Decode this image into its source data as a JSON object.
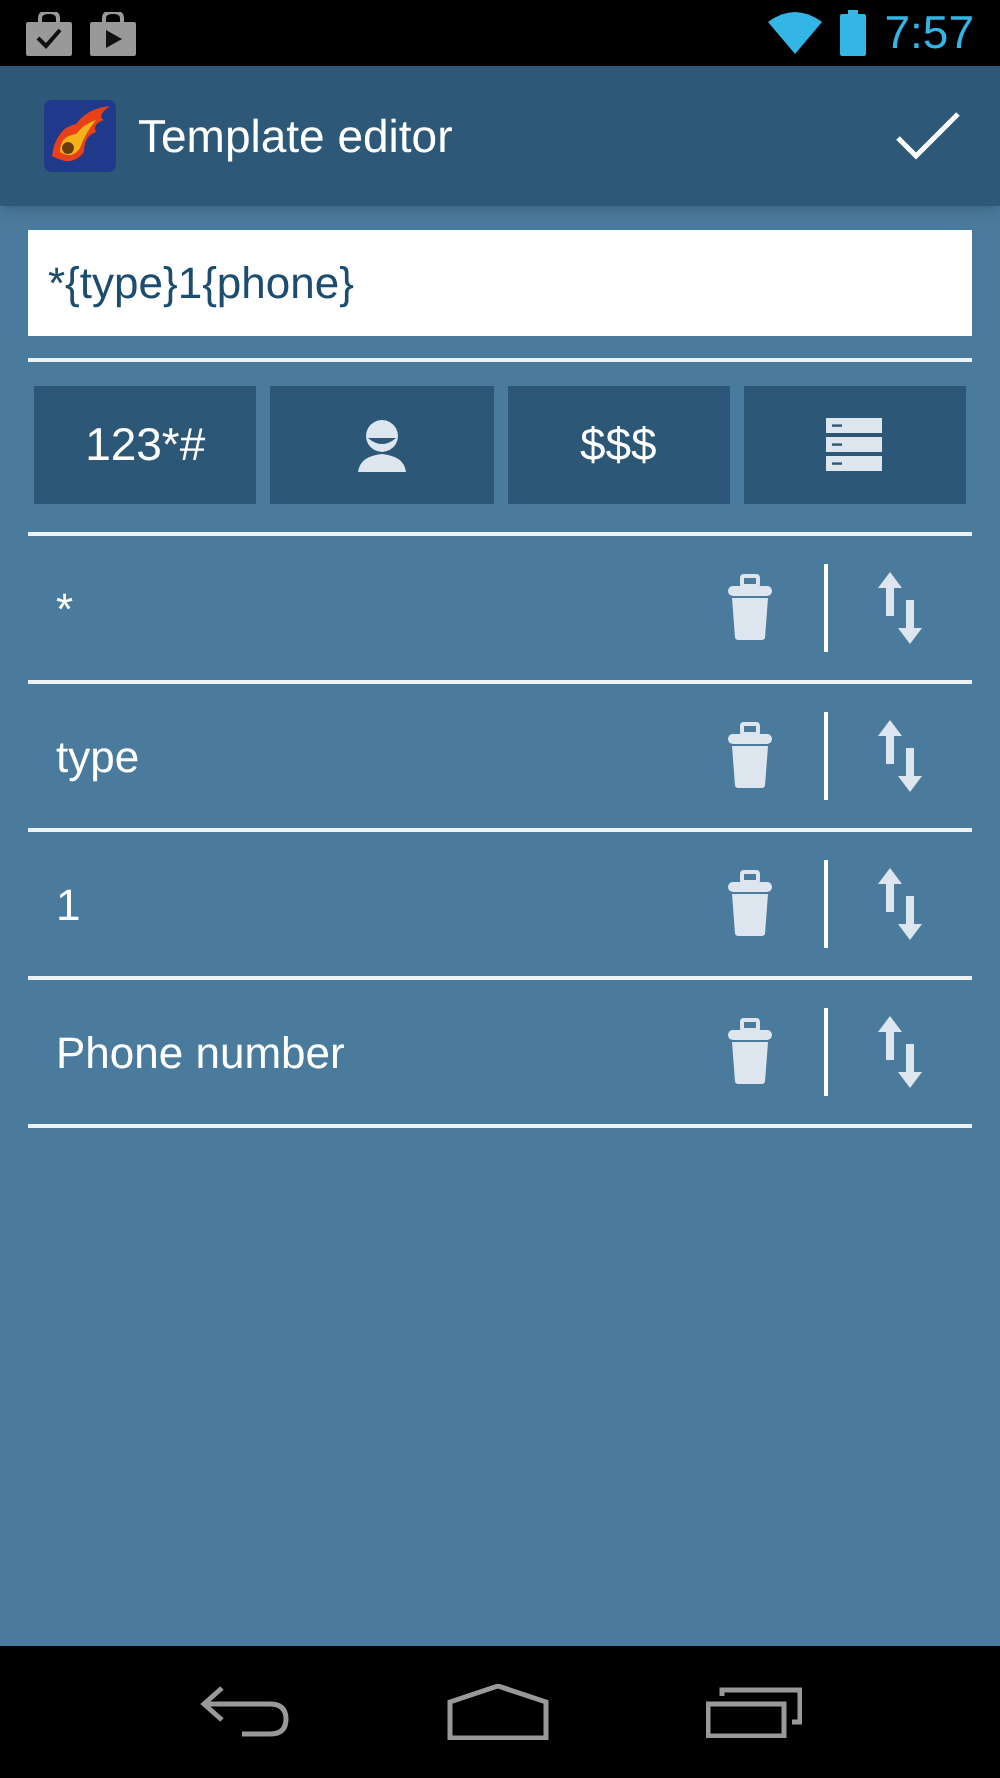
{
  "status_bar": {
    "time": "7:57"
  },
  "action_bar": {
    "title": "Template editor"
  },
  "template_field": {
    "value": "*{type}1{phone}"
  },
  "toolbar": [
    {
      "kind": "text",
      "label": "123*#"
    },
    {
      "kind": "contact"
    },
    {
      "kind": "text",
      "label": "$$$"
    },
    {
      "kind": "list"
    }
  ],
  "items": [
    {
      "label": "*"
    },
    {
      "label": "type"
    },
    {
      "label": "1"
    },
    {
      "label": "Phone number"
    }
  ]
}
